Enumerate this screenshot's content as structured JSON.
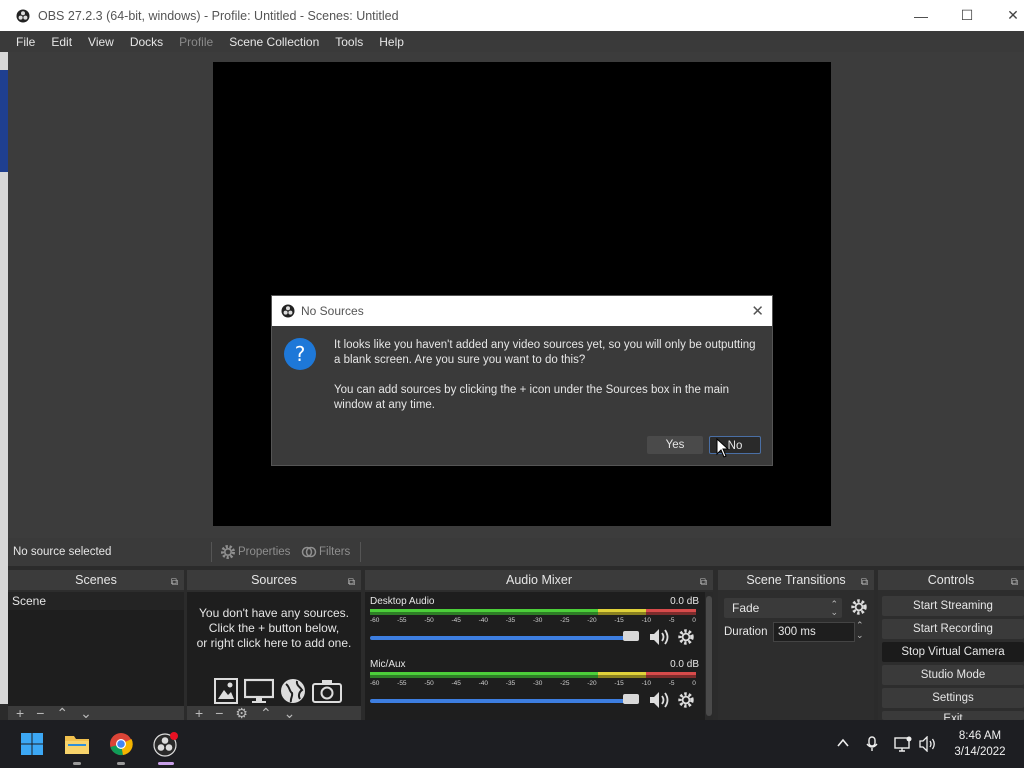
{
  "window": {
    "title": "OBS 27.2.3 (64-bit, windows) - Profile: Untitled - Scenes: Untitled",
    "minimize": "—",
    "maximize": "☐",
    "close": "✕"
  },
  "menu": [
    "File",
    "Edit",
    "View",
    "Docks",
    "Profile",
    "Scene Collection",
    "Tools",
    "Help"
  ],
  "source_bar": {
    "status": "No source selected",
    "properties": "Properties",
    "filters": "Filters"
  },
  "docks": {
    "scenes": {
      "title": "Scenes",
      "items": [
        "Scene"
      ]
    },
    "sources": {
      "title": "Sources",
      "empty_lines": [
        "You don't have any sources.",
        "Click the + button below,",
        "or right click here to add one."
      ]
    },
    "mixer": {
      "title": "Audio Mixer",
      "channels": [
        {
          "name": "Desktop Audio",
          "db": "0.0 dB"
        },
        {
          "name": "Mic/Aux",
          "db": "0.0 dB"
        }
      ],
      "ticks": [
        "-60",
        "-55",
        "-50",
        "-45",
        "-40",
        "-35",
        "-30",
        "-25",
        "-20",
        "-15",
        "-10",
        "-5",
        "0"
      ]
    },
    "transitions": {
      "title": "Scene Transitions",
      "selected": "Fade",
      "duration_label": "Duration",
      "duration_value": "300 ms"
    },
    "controls": {
      "title": "Controls",
      "buttons": [
        "Start Streaming",
        "Start Recording",
        "Stop Virtual Camera",
        "Studio Mode",
        "Settings",
        "Exit"
      ]
    }
  },
  "dialog": {
    "title": "No Sources",
    "close": "✕",
    "icon": "?",
    "text1": "It looks like you haven't added any video sources yet, so you will only be outputting a blank screen. Are you sure you want to do this?",
    "text2": "You can add sources by clicking the + icon under the Sources box in the main window at any time.",
    "yes": "Yes",
    "no": "No"
  },
  "taskbar": {
    "time": "8:46 AM",
    "date": "3/14/2022"
  },
  "colors": {
    "accent": "#1e78d8",
    "fader": "#3d7ee0"
  }
}
